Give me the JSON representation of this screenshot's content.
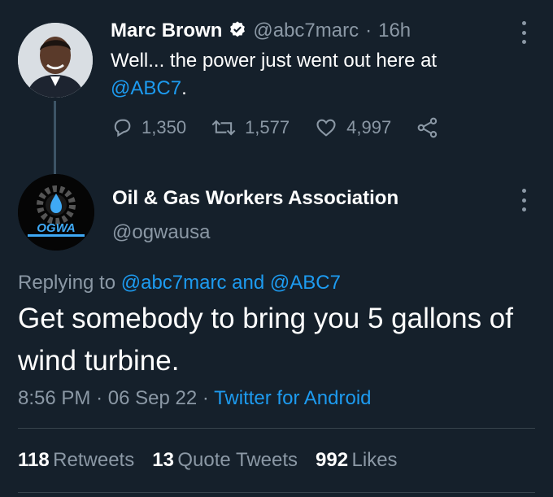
{
  "original_tweet": {
    "author_name": "Marc Brown",
    "handle": "@abc7marc",
    "separator": "·",
    "time": "16h",
    "text_prefix": "Well... the power just went out here at",
    "mention": "@ABC7",
    "text_suffix": ".",
    "metrics": {
      "replies": "1,350",
      "retweets": "1,577",
      "likes": "4,997"
    }
  },
  "reply_tweet": {
    "author_name": "Oil & Gas Workers Association",
    "handle": "@ogwausa",
    "logo_text": "OGWA",
    "replying_to_label": "Replying to",
    "replying_to_1": "@abc7marc",
    "replying_and": "and",
    "replying_to_2": "@ABC7",
    "text": "Get somebody to bring you 5 gallons of wind turbine.",
    "time": "8:56 PM",
    "sep1": "·",
    "date": "06 Sep 22",
    "sep2": "·",
    "source": "Twitter for Android"
  },
  "stats": {
    "retweets_count": "118",
    "retweets_label": "Retweets",
    "quotes_count": "13",
    "quotes_label": "Quote Tweets",
    "likes_count": "992",
    "likes_label": "Likes"
  },
  "colors": {
    "background": "#15202b",
    "text": "#ffffff",
    "muted": "#8b98a5",
    "accent": "#1d9bf0"
  },
  "icons": [
    "verified-badge-icon",
    "reply-icon",
    "retweet-icon",
    "like-icon",
    "share-icon",
    "more-icon"
  ]
}
